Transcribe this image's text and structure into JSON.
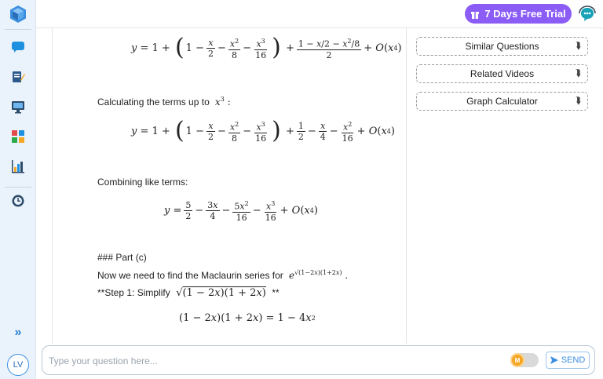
{
  "header": {
    "trial_label": "7 Days Free Trial"
  },
  "sidebar": {
    "avatar_initials": "LV",
    "expand_glyph": "»",
    "icons": [
      "chat-icon",
      "notes-icon",
      "monitor-icon",
      "dashboard-icon",
      "chart-icon",
      "history-icon"
    ]
  },
  "content": {
    "text_terms_up_to": "Calculating the terms up to",
    "text_combining": "Combining like terms:",
    "text_part_c": "### Part (c)",
    "text_maclaurin": "Now we need to find the Maclaurin series for",
    "text_step1": "**Step 1: Simplify",
    "text_step1_end": "**"
  },
  "side_panel": {
    "items": [
      {
        "label": "Similar Questions"
      },
      {
        "label": "Related Videos"
      },
      {
        "label": "Graph Calculator"
      }
    ]
  },
  "input": {
    "placeholder": "Type your question here...",
    "send_label": "SEND",
    "toggle_letter": "M"
  },
  "colors": {
    "accent": "#8b5cf6",
    "brand_blue": "#3b8ee0",
    "rail_bg": "#eaf3fb"
  }
}
